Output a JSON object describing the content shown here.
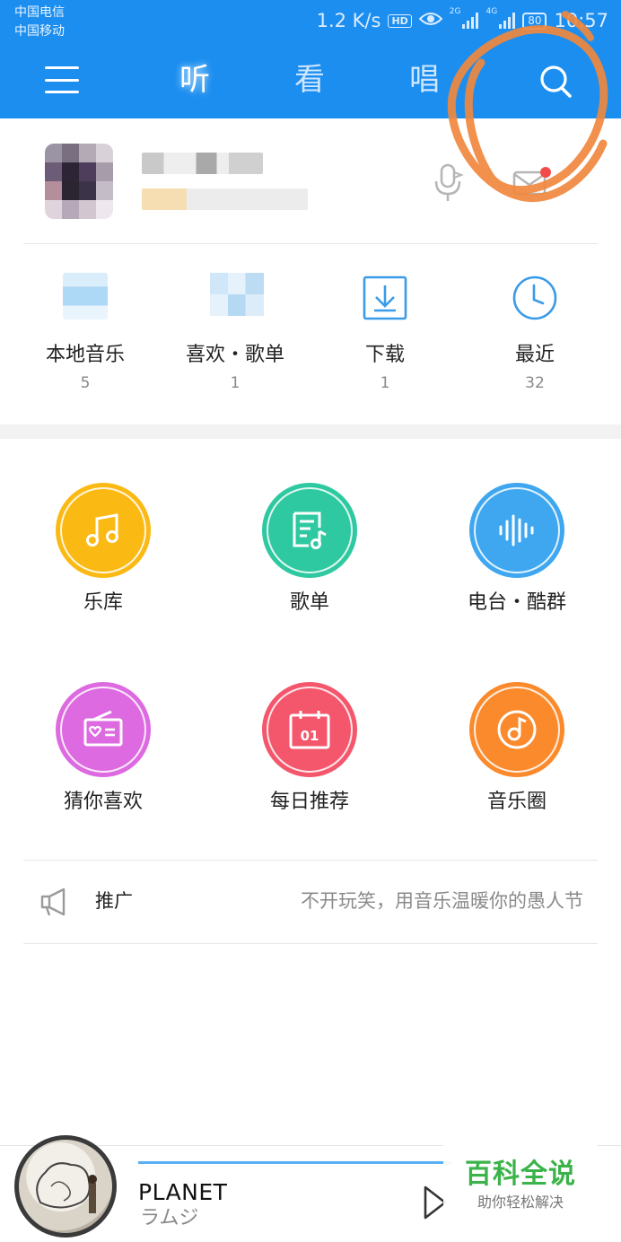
{
  "status_bar": {
    "carrier_1": "中国电信",
    "carrier_2": "中国移动",
    "net_speed": "1.2 K/s",
    "hd_badge": "HD",
    "signal_1_type": "2G",
    "signal_2_type": "4G",
    "battery": "80",
    "time": "10:57"
  },
  "header": {
    "tabs": [
      {
        "label": "听",
        "active": true
      },
      {
        "label": "看",
        "active": false
      },
      {
        "label": "唱",
        "active": false
      }
    ],
    "icons": [
      "menu-icon",
      "search-icon"
    ],
    "accent_color": "#1b8ef0"
  },
  "profile": {
    "icons": [
      "microphone-icon",
      "mail-icon"
    ]
  },
  "quick_access": [
    {
      "label": "本地音乐",
      "count": "5",
      "icon": "local-music-icon"
    },
    {
      "label": "喜欢・歌单",
      "count": "1",
      "icon": "favorites-icon"
    },
    {
      "label": "下载",
      "count": "1",
      "icon": "download-icon"
    },
    {
      "label": "最近",
      "count": "32",
      "icon": "clock-icon"
    }
  ],
  "features": [
    {
      "label": "乐库",
      "icon": "music-note-icon",
      "color": "#fbb914"
    },
    {
      "label": "歌单",
      "icon": "playlist-icon",
      "color": "#2ec9a0"
    },
    {
      "label": "电台・酷群",
      "icon": "soundwave-icon",
      "color": "#3ea7f0"
    },
    {
      "label": "猜你喜欢",
      "icon": "radio-heart-icon",
      "color": "#dd6ae0"
    },
    {
      "label": "每日推荐",
      "icon": "calendar-icon",
      "color": "#f4566c",
      "icon_text": "01"
    },
    {
      "label": "音乐圈",
      "icon": "music-circle-icon",
      "color": "#fb8a2c"
    }
  ],
  "promo": {
    "label": "推广",
    "text": "不开玩笑，用音乐温暖你的愚人节",
    "icon": "megaphone-icon"
  },
  "player": {
    "title": "PLANET",
    "artist": "ラムジ",
    "icons": [
      "play-icon"
    ]
  },
  "watermark": {
    "title": "百科全说",
    "subtitle": "助你轻松解决",
    "color": "#3bb34a"
  },
  "annotation": {
    "color": "#f0883e"
  }
}
